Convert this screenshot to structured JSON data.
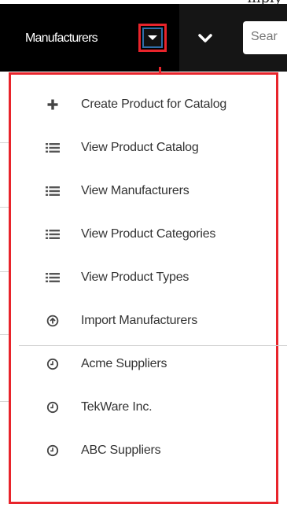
{
  "caption_fragment": "mply",
  "navbar": {
    "module_title": "Manufacturers",
    "search_placeholder": "Sear",
    "colors": {
      "bar": "#151515",
      "active_tab": "#000000",
      "highlight": "#e8242b"
    }
  },
  "menu": {
    "actions": [
      {
        "label": "Create Product for Catalog",
        "icon": "plus-icon"
      },
      {
        "label": "View Product Catalog",
        "icon": "list-icon"
      },
      {
        "label": "View Manufacturers",
        "icon": "list-icon"
      },
      {
        "label": "View Product Categories",
        "icon": "list-icon"
      },
      {
        "label": "View Product Types",
        "icon": "list-icon"
      },
      {
        "label": "Import Manufacturers",
        "icon": "upload-icon"
      }
    ],
    "recent": [
      {
        "label": "Acme Suppliers",
        "icon": "clock-icon"
      },
      {
        "label": "TekWare Inc.",
        "icon": "clock-icon"
      },
      {
        "label": "ABC Suppliers",
        "icon": "clock-icon"
      }
    ]
  }
}
